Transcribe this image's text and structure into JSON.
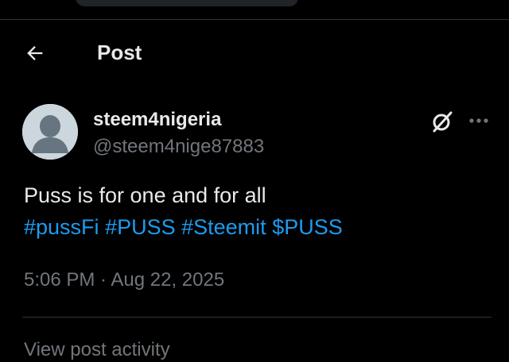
{
  "header": {
    "title": "Post",
    "back_icon": "arrow-left-icon"
  },
  "author": {
    "display_name": "steem4nigeria",
    "handle": "@steem4nige87883",
    "avatar": "default-avatar-icon"
  },
  "actions": {
    "grok_icon": "grok-icon",
    "more_icon": "more-horizontal-icon"
  },
  "post": {
    "text": "Puss is for one and for all",
    "hashtags": [
      "#pussFi",
      "#PUSS",
      "#Steemit",
      "$PUSS"
    ]
  },
  "meta": {
    "time": "5:06 PM",
    "separator": " · ",
    "date": "Aug 22, 2025"
  },
  "footer": {
    "cut_text": "View post activity"
  },
  "colors": {
    "background": "#000000",
    "text_primary": "#e7e9ea",
    "text_secondary": "#71767b",
    "link": "#1d9bf0",
    "divider": "#2f3336"
  }
}
